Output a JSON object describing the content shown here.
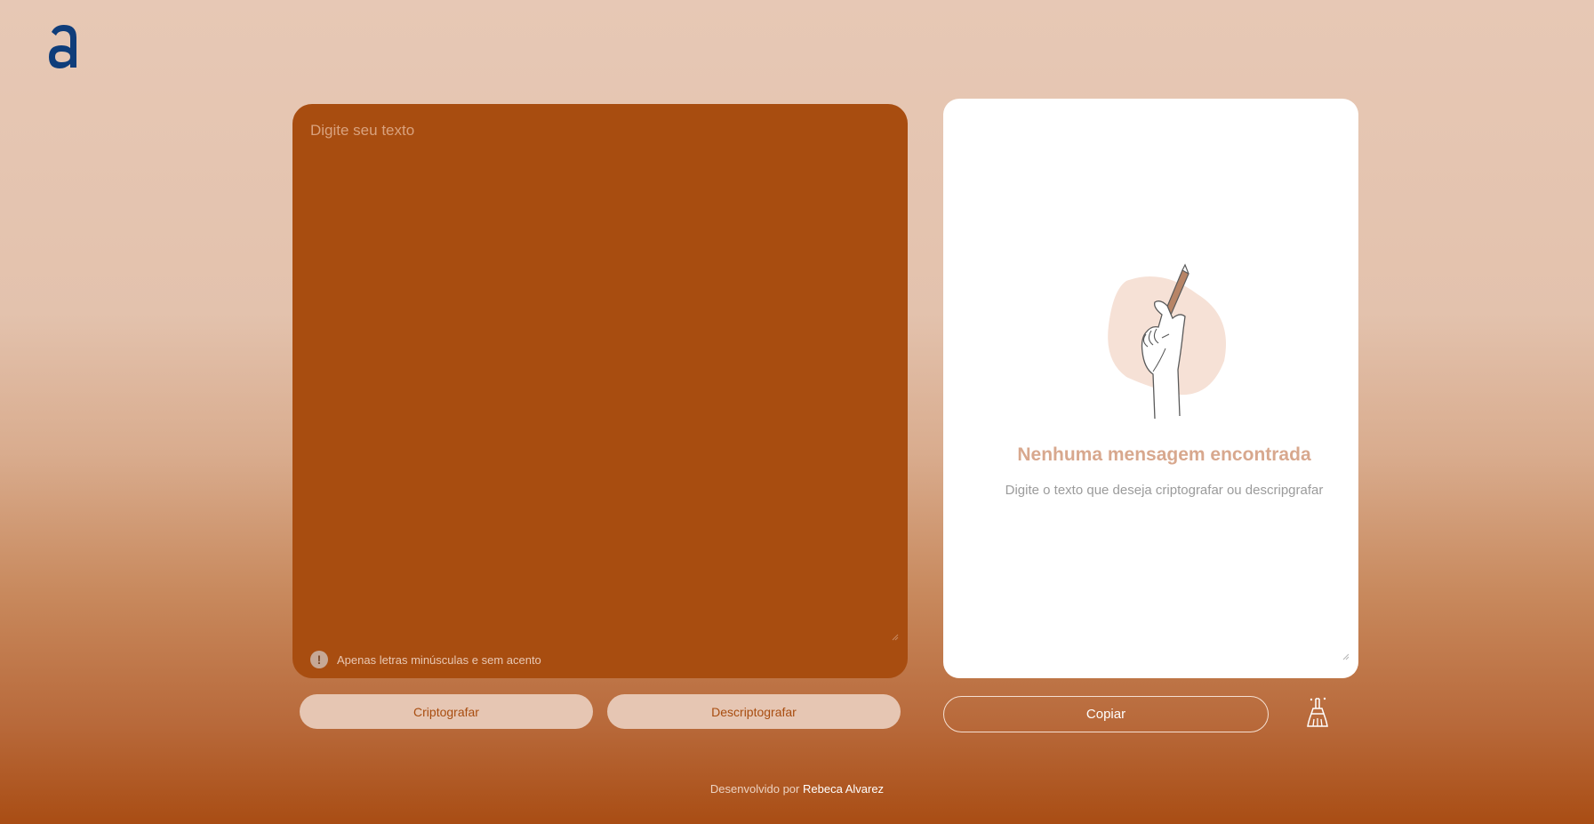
{
  "logo": {
    "icon": "letter-a-logo",
    "color": "#0f3d7a"
  },
  "input": {
    "placeholder": "Digite seu texto",
    "value": "",
    "hint_icon": "!",
    "hint_text": "Apenas letras minúsculas e sem acento"
  },
  "actions": {
    "encrypt_label": "Criptografar",
    "decrypt_label": "Descriptografar"
  },
  "output": {
    "illustration": "hand-holding-pencil-icon",
    "empty_title": "Nenhuma mensagem encontrada",
    "empty_subtitle": "Digite o texto que deseja criptografar ou descripgrafar"
  },
  "output_actions": {
    "copy_label": "Copiar",
    "clear_icon": "broom-icon"
  },
  "footer": {
    "prefix": "Desenvolvido por",
    "author": "Rebeca Alvarez"
  },
  "colors": {
    "accent": "#a84d10",
    "button_bg": "#e6c6b3",
    "panel_bg": "#ffffff",
    "title_muted": "#d8a88e"
  }
}
